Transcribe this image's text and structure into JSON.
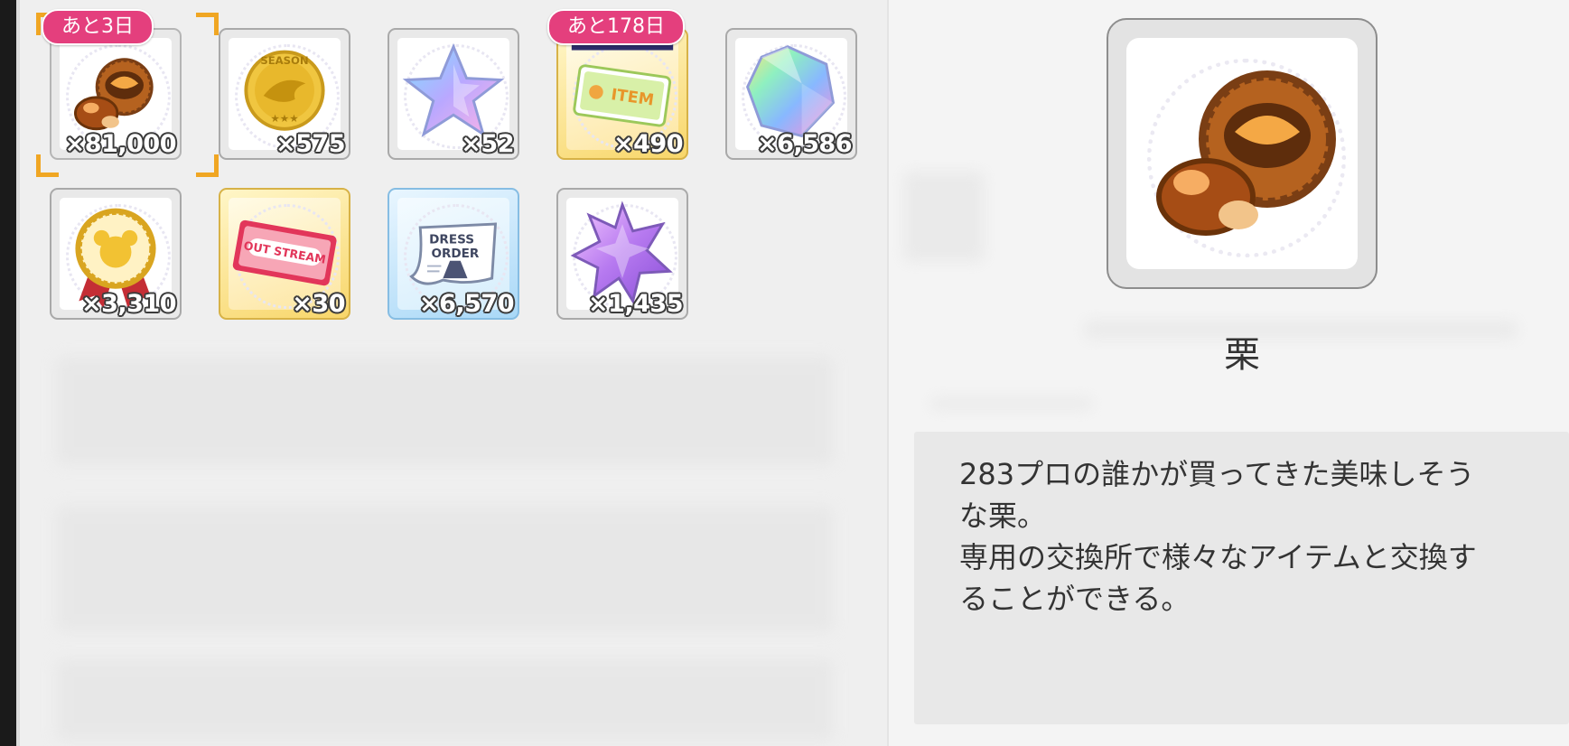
{
  "items": [
    {
      "name": "栗",
      "count": "×81,000",
      "icon": "chestnut-icon",
      "badge": "あと3日",
      "selected": true
    },
    {
      "name": "シーズンメダル",
      "count": "×575",
      "icon": "season-coin-icon"
    },
    {
      "name": "スター",
      "count": "×52",
      "icon": "rainbow-star-icon"
    },
    {
      "name": "アイテムチケット",
      "count": "×490",
      "icon": "item-ticket-icon",
      "badge": "あと178日"
    },
    {
      "name": "クリスタル",
      "count": "×6,586",
      "icon": "rainbow-crystal-icon"
    },
    {
      "name": "メダル",
      "count": "×3,310",
      "icon": "gold-medal-icon"
    },
    {
      "name": "チケット",
      "count": "×30",
      "icon": "outstream-ticket-icon"
    },
    {
      "name": "ドレスオーダー",
      "count": "×6,570",
      "icon": "dress-order-icon"
    },
    {
      "name": "ピース",
      "count": "×1,435",
      "icon": "purple-star-piece-icon"
    }
  ],
  "detail": {
    "name": "栗",
    "icon": "chestnut-icon",
    "description": "283プロの誰かが買ってきた美味しそう\nな栗。\n専用の交換所で様々なアイテムと交換す\nることができる。"
  },
  "colors": {
    "badge": "#e43f7d",
    "selection_corner": "#f0a623",
    "panel_bg": "#efefef",
    "desc_bg": "#e8e8e8"
  }
}
